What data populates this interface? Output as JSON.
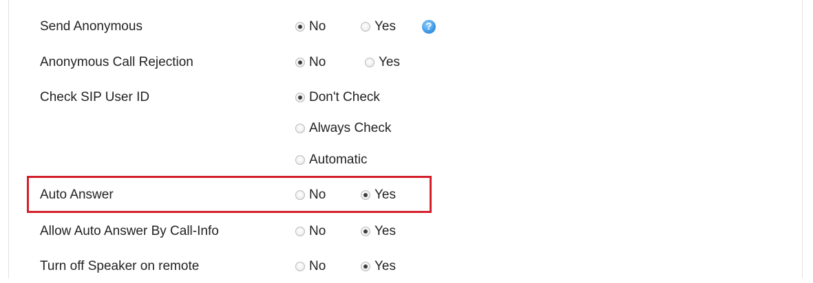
{
  "colors": {
    "highlight_border": "#d41f2a",
    "help_icon": "#3d98e6"
  },
  "settings": [
    {
      "label": "Send Anonymous",
      "options": [
        {
          "label": "No",
          "checked": true
        },
        {
          "label": "Yes",
          "checked": false
        }
      ],
      "help_icon": "question-mark-icon",
      "help_glyph": "?"
    },
    {
      "label": "Anonymous Call Rejection",
      "options": [
        {
          "label": "No",
          "checked": true
        },
        {
          "label": "Yes",
          "checked": false
        }
      ]
    },
    {
      "label": "Check SIP User ID",
      "options": [
        {
          "label": "Don't Check",
          "checked": true
        },
        {
          "label": "Always Check",
          "checked": false
        },
        {
          "label": "Automatic",
          "checked": false
        }
      ]
    },
    {
      "label": "Auto Answer",
      "highlighted": true,
      "options": [
        {
          "label": "No",
          "checked": false
        },
        {
          "label": "Yes",
          "checked": true
        }
      ]
    },
    {
      "label": "Allow Auto Answer By Call-Info",
      "options": [
        {
          "label": "No",
          "checked": false
        },
        {
          "label": "Yes",
          "checked": true
        }
      ]
    },
    {
      "label": "Turn off Speaker on remote",
      "options": [
        {
          "label": "No",
          "checked": false
        },
        {
          "label": "Yes",
          "checked": true
        }
      ]
    }
  ]
}
